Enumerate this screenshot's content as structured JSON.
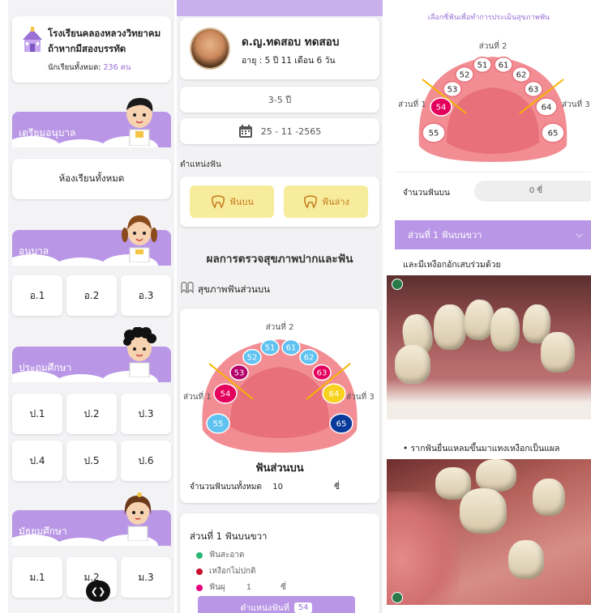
{
  "panel1": {
    "school_name_line1": "โรงเรียนคลองหลวงวิทยาคม",
    "school_name_line2": "ถ้าหากมีสองบรรทัด",
    "student_count_label": "นักเรียนทั้งหมด:",
    "student_count_value": "236 คน",
    "sections": [
      {
        "label": "เตรียมอนุบาล"
      },
      {
        "label": "อนุบาล"
      },
      {
        "label": "ประถมศึกษา"
      },
      {
        "label": "มัธยมศึกษา"
      }
    ],
    "all_rooms_label": "ห้องเรียนทั้งหมด",
    "kindergarten_rooms": [
      "อ.1",
      "อ.2",
      "อ.3"
    ],
    "primary_rooms": [
      "ป.1",
      "ป.2",
      "ป.3",
      "ป.4",
      "ป.5",
      "ป.6"
    ],
    "secondary_rooms": [
      "ม.1",
      "ม.2",
      "ม.3"
    ],
    "nav_icon": "prev-next-arrows"
  },
  "panel2": {
    "patient_name": "ด.ญ.ทดสอบ ทดสอบ",
    "patient_age": "อายุ : 5 ปี 11 เดือน 6 วัน",
    "age_range": "3-5 ปี",
    "date": "25 - 11 -2565",
    "tooth_position_label": "ตำแหน่งฟัน",
    "upper_teeth_button": "ฟันบน",
    "lower_teeth_button": "ฟันล่าง",
    "result_title": "ผลการตรวจสุขภาพปากและฟัน",
    "health_section_title": "สุขภาพฟันส่วนบน",
    "chart_section_labels": {
      "s1": "ส่วนที่ 1",
      "s2": "ส่วนที่ 2",
      "s3": "ส่วนที่ 3"
    },
    "chart_teeth": [
      {
        "id": "51"
      },
      {
        "id": "61"
      },
      {
        "id": "52"
      },
      {
        "id": "62"
      },
      {
        "id": "53"
      },
      {
        "id": "63"
      },
      {
        "id": "54"
      },
      {
        "id": "64"
      },
      {
        "id": "55"
      },
      {
        "id": "65"
      }
    ],
    "upper_section_title": "ฟันส่วนบน",
    "upper_count_label": "จำนวนฟันบนทั้งหมด",
    "upper_count_value": "10",
    "upper_count_unit": "ซี่",
    "section1_title": "ส่วนที่ 1 ฟันบนขวา",
    "legend": [
      {
        "label": "ฟันสะอาด",
        "color": "#2bb673"
      },
      {
        "label": "เหงือกไม่ปกติ",
        "color": "#c8102e"
      },
      {
        "label": "ฟันผุ",
        "color": "#e6007e",
        "count": "1",
        "unit": "ซี่"
      }
    ],
    "position_button_label": "ตำแหน่งฟันที่",
    "position_button_value": "54",
    "colors": {
      "gum": "#f28d93",
      "palate": "#e8707a",
      "tooth_blue": "#5fc2f0",
      "tooth_pink": "#e4005d",
      "tooth_dark_magenta": "#b3006b",
      "tooth_yellow": "#f7d21e",
      "tooth_navy": "#0b3b9a",
      "line_yellow": "#f4b400"
    }
  },
  "panel3": {
    "top_hint": "เลือกซี่ฟันเพื่อทำการประเมินสุขภาพฟัน",
    "chart_section_labels": {
      "s1": "ส่วนที่ 1",
      "s2": "ส่วนที่ 2",
      "s3": "ส่วนที่ 3"
    },
    "teeth": [
      "51",
      "61",
      "52",
      "62",
      "53",
      "63",
      "54",
      "64",
      "55",
      "65"
    ],
    "selected_tooth": "54",
    "count_label": "จำนวนฟันบน",
    "count_value": "0 ซี่",
    "accordion_title": "ส่วนที่ 1 ฟันบนขวา",
    "note1": "และมีเหงือกอักเสบร่วมด้วย",
    "note2": "• รากฟันยื่นแหลมขึ้นมาแทงเหงือกเป็นแผล",
    "accent_color": "#b997e6"
  }
}
